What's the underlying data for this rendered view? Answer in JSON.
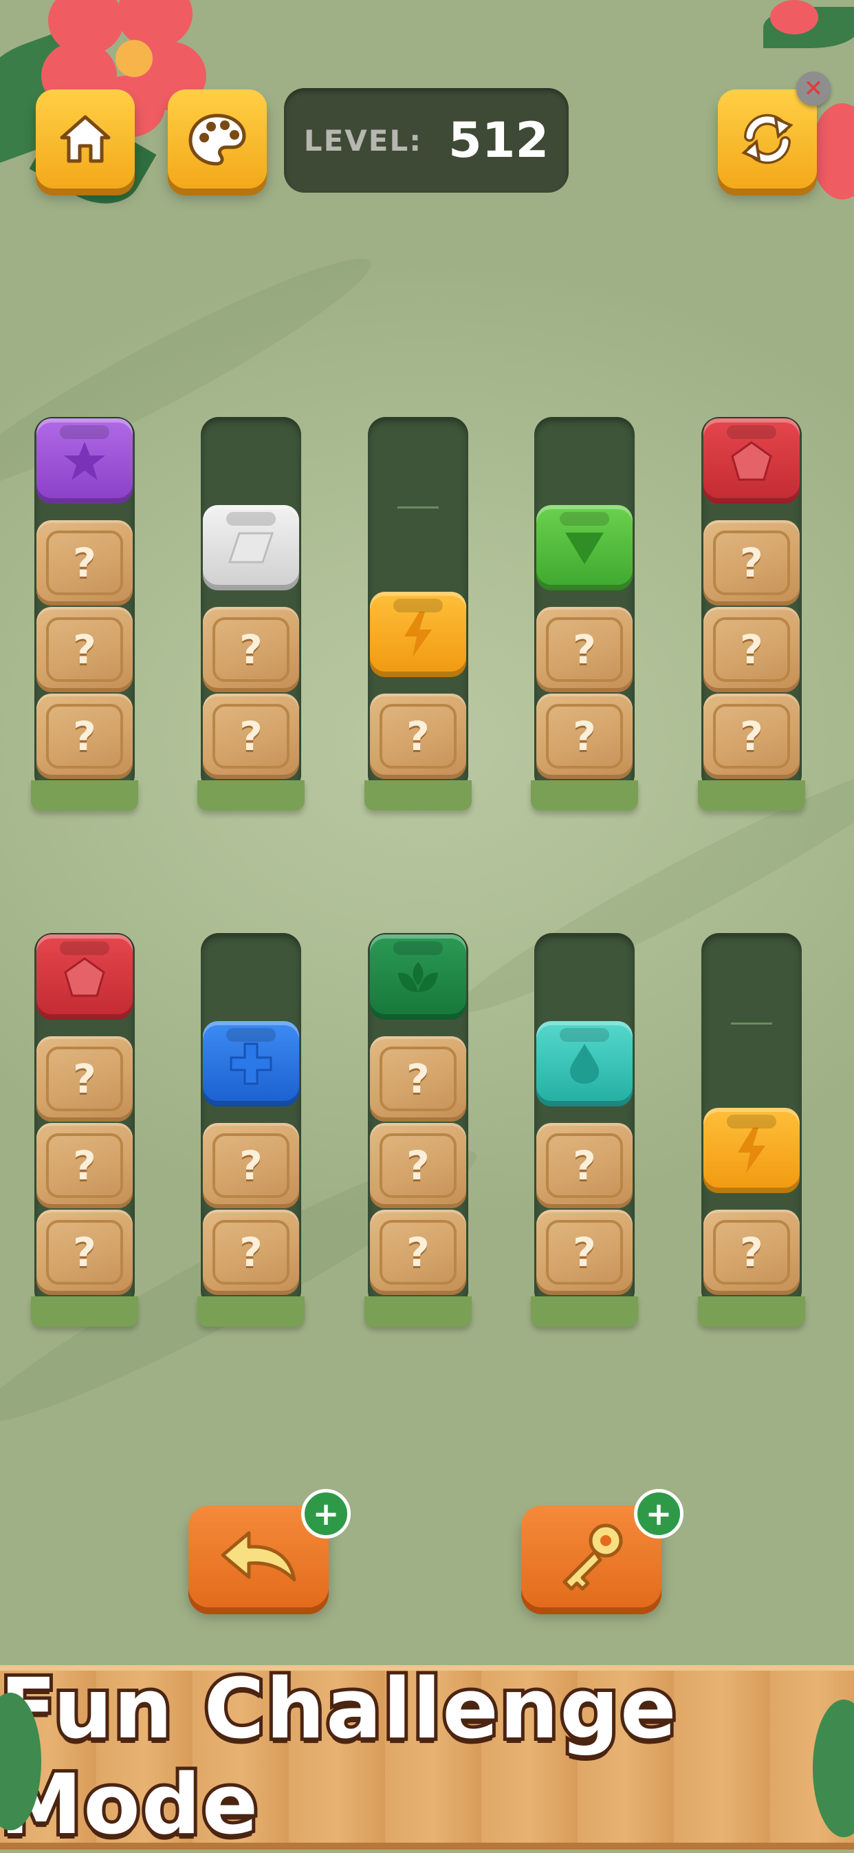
{
  "header": {
    "level_label": "LEVEL:",
    "level_value": "512",
    "home_icon": "home-icon",
    "palette_icon": "palette-icon",
    "restart_icon": "refresh-icon",
    "close_icon": "close-icon"
  },
  "hidden_symbol": "?",
  "colors": {
    "purple": "#9b4fd3",
    "white": "#e4e4e4",
    "orange": "#f6a51f",
    "green": "#4bb83a",
    "red": "#d6383e",
    "blue": "#1f6fe0",
    "dark_green": "#1f8a47",
    "teal": "#34c4b8",
    "wood": "#d4a46a",
    "tube": "#3e553a"
  },
  "tubes_row1": [
    {
      "top": "purple-star",
      "hidden": 3
    },
    {
      "top": "white-parallelogram",
      "hidden": 2
    },
    {
      "top": "orange-lightning",
      "hidden": 1
    },
    {
      "top": "green-triangle",
      "hidden": 2
    },
    {
      "top": "red-pentagon",
      "hidden": 3
    }
  ],
  "tubes_row2": [
    {
      "top": "red-pentagon",
      "hidden": 3
    },
    {
      "top": "blue-cross",
      "hidden": 2
    },
    {
      "top": "dark-green-leaf",
      "hidden": 3
    },
    {
      "top": "teal-drop",
      "hidden": 2
    },
    {
      "top": "orange-lightning",
      "hidden": 1
    }
  ],
  "actions": {
    "undo_icon": "undo-arrow-icon",
    "hint_icon": "key-icon",
    "add_symbol": "+"
  },
  "banner": {
    "text": "Fun Challenge Mode"
  }
}
